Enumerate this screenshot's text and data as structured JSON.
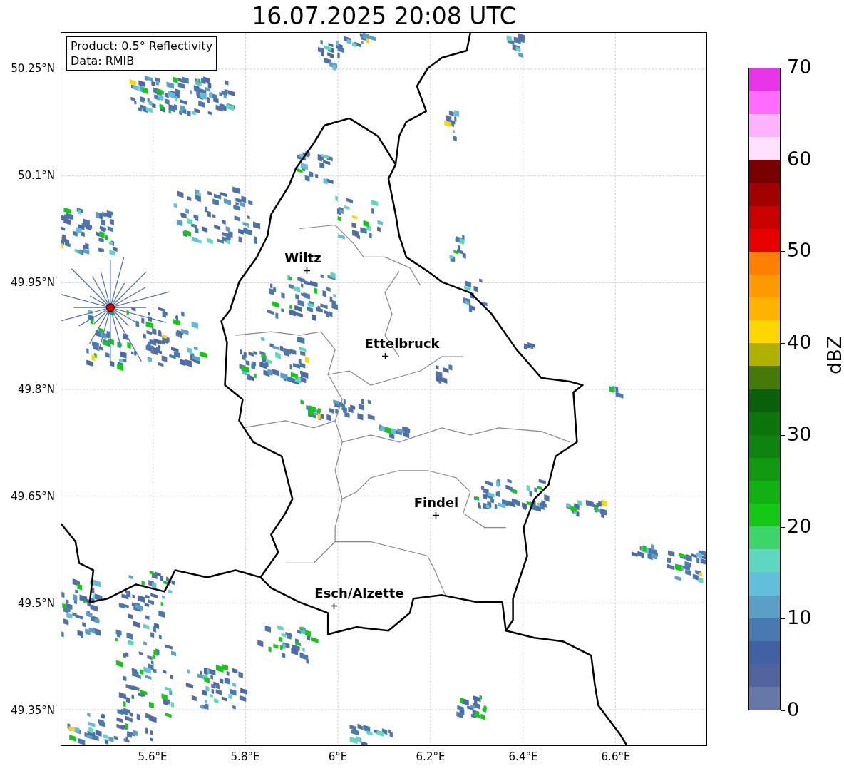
{
  "title": "16.07.2025 20:08 UTC",
  "legend": [
    "Product: 0.5° Reflectivity",
    "Data: RMIB"
  ],
  "x_ticks": [
    "5.6°E",
    "5.8°E",
    "6°E",
    "6.2°E",
    "6.4°E",
    "6.6°E"
  ],
  "y_ticks": [
    "50.25°N",
    "50.1°N",
    "49.95°N",
    "49.8°N",
    "49.65°N",
    "49.5°N",
    "49.35°N"
  ],
  "cities": [
    {
      "name": "Wiltz"
    },
    {
      "name": "Ettelbruck"
    },
    {
      "name": "Findel"
    },
    {
      "name": "Esch/Alzette"
    }
  ],
  "colorbar": {
    "label": "dBZ",
    "ticks": [
      "70",
      "60",
      "50",
      "40",
      "30",
      "20",
      "10",
      "0"
    ],
    "segments": [
      {
        "color": "#e935e9"
      },
      {
        "color": "#ff6bff"
      },
      {
        "color": "#ffb3ff"
      },
      {
        "color": "#ffe0ff"
      },
      {
        "color": "#7a0000"
      },
      {
        "color": "#a30000"
      },
      {
        "color": "#c80000"
      },
      {
        "color": "#e60000"
      },
      {
        "color": "#ff7f00"
      },
      {
        "color": "#ff9900"
      },
      {
        "color": "#ffb300"
      },
      {
        "color": "#ffd700"
      },
      {
        "color": "#b0b000"
      },
      {
        "color": "#457a0a"
      },
      {
        "color": "#0a5f0a"
      },
      {
        "color": "#0b740b"
      },
      {
        "color": "#0f820f"
      },
      {
        "color": "#119911"
      },
      {
        "color": "#13b013"
      },
      {
        "color": "#15c815"
      },
      {
        "color": "#3dd46a"
      },
      {
        "color": "#5fd6c0"
      },
      {
        "color": "#62bfdc"
      },
      {
        "color": "#5b9ec8"
      },
      {
        "color": "#4a78b0"
      },
      {
        "color": "#4260a4"
      },
      {
        "color": "#52649e"
      },
      {
        "color": "#6677a8"
      }
    ]
  }
}
